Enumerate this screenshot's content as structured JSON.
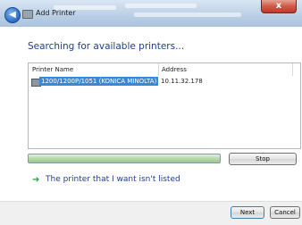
{
  "window": {
    "title": "Add Printer",
    "close_glyph": "x"
  },
  "heading": "Searching for available printers...",
  "table": {
    "columns": [
      "Printer Name",
      "Address"
    ],
    "rows": [
      {
        "name": "1200/1200P/1051 (KONICA MINOLTA)",
        "address": "10.11.32.178",
        "selected": true
      }
    ]
  },
  "progress": {
    "fraction": 0.98
  },
  "buttons": {
    "stop": "Stop",
    "next": "Next",
    "cancel": "Cancel"
  },
  "not_listed_link": "The printer that I want isn't listed",
  "icons": {
    "back": "back-arrow-icon",
    "printer": "printer-icon",
    "link_arrow": "green-arrow-icon"
  }
}
